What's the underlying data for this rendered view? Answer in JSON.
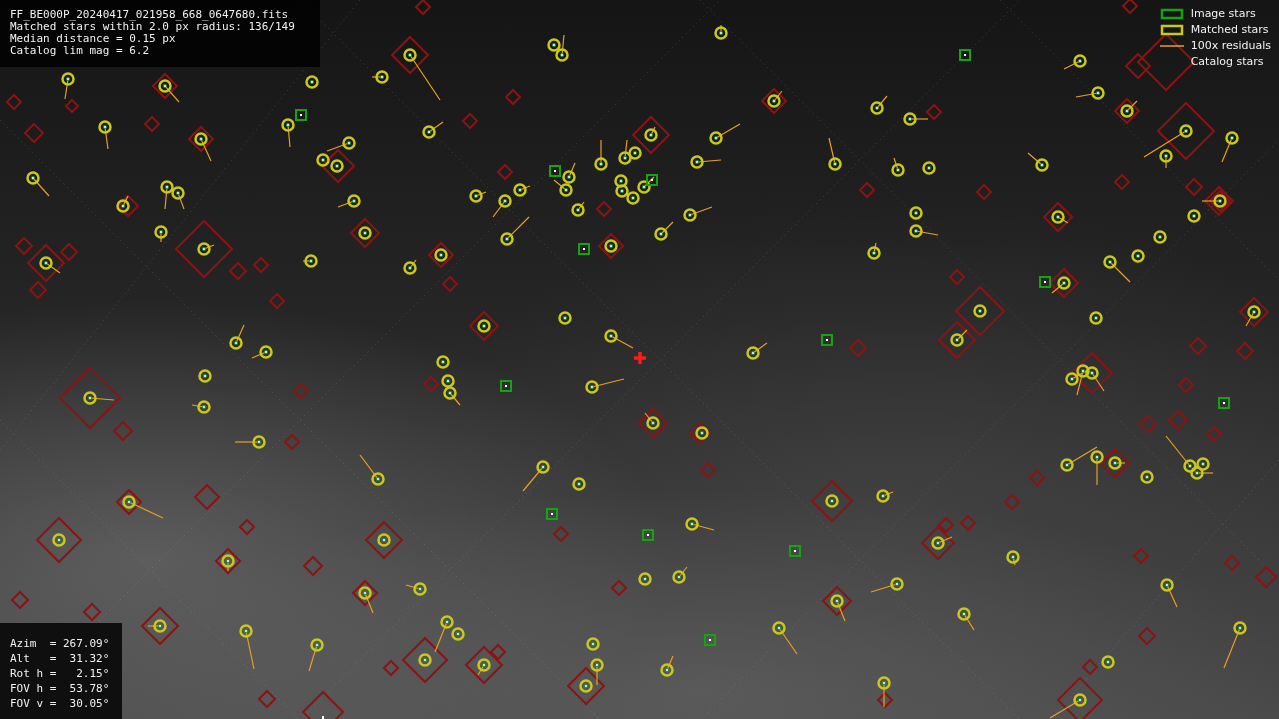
{
  "fit_info": {
    "lines": [
      "FF_BE000P_20240417_021958_668_0647680.fits",
      "Matched stars within 2.0 px radius: 136/149",
      "Median distance = 0.15 px",
      "Catalog lim mag = 6.2"
    ]
  },
  "legend": [
    {
      "kind": "image",
      "label": "Image stars"
    },
    {
      "kind": "matched",
      "label": "Matched stars"
    },
    {
      "kind": "residual",
      "label": "100x residuals"
    },
    {
      "kind": "catalog",
      "label": "Catalog stars"
    }
  ],
  "pointing": {
    "lines": [
      "Azim  = 267.09°",
      "Alt   =  31.32°",
      "Rot h =   2.15°",
      "FOV h =  53.78°",
      "FOV v =  30.05°"
    ]
  }
}
